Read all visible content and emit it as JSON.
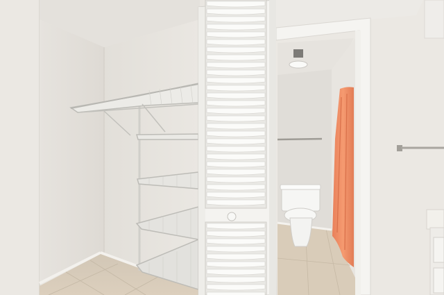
{
  "scene": {
    "description_visible_text": [],
    "palette": {
      "wall_light": "#ebe8e3",
      "wall_shadow": "#dcd8d2",
      "ceiling": "#e4e1dc",
      "door_white": "#f4f3f0",
      "louver_shadow": "#d9d7d2",
      "floor_tile": "#d8cdbb",
      "floor_tile_dark": "#c9bca8",
      "shelf_wire": "#c9c8c3",
      "curtain": "#f2936a",
      "curtain_dark": "#e07b53",
      "toilet": "#f6f6f4",
      "towel_bar": "#a8a59f"
    },
    "objects": [
      "closet-wall-left",
      "wire-shelving",
      "louvered-bifold-door",
      "bathroom-doorway",
      "toilet",
      "shower-curtain",
      "towel-bar",
      "vanity-edge",
      "ceiling-light"
    ]
  }
}
